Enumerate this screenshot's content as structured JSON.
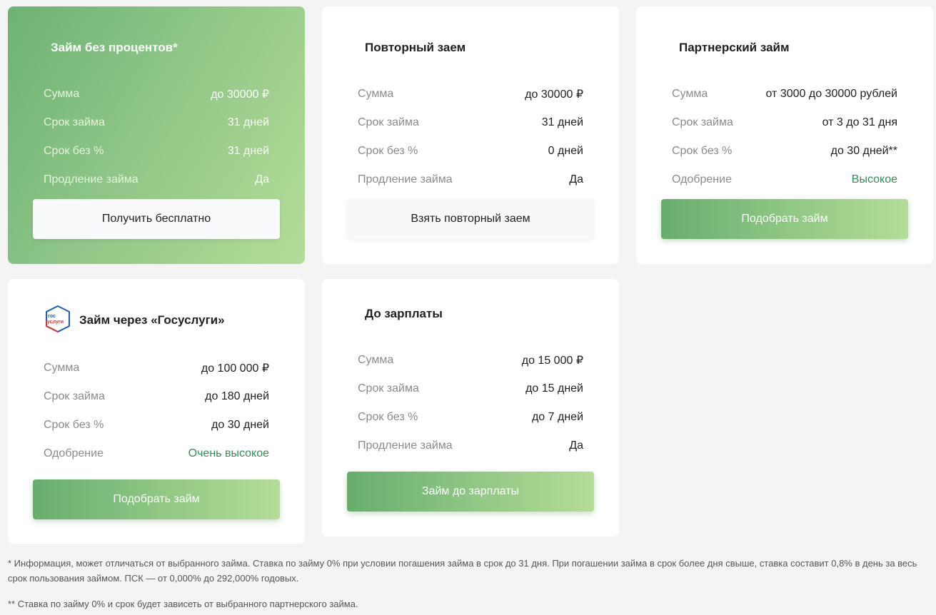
{
  "cards": [
    {
      "title": "Займ без процентов*",
      "rows": [
        {
          "label": "Сумма",
          "value": "до 30000 ₽"
        },
        {
          "label": "Срок займа",
          "value": "31 дней"
        },
        {
          "label": "Срок без %",
          "value": "31 дней"
        },
        {
          "label": "Продление займа",
          "value": "Да"
        }
      ],
      "button": "Получить бесплатно"
    },
    {
      "title": "Повторный заем",
      "rows": [
        {
          "label": "Сумма",
          "value": "до 30000 ₽"
        },
        {
          "label": "Срок займа",
          "value": "31 дней"
        },
        {
          "label": "Срок без %",
          "value": "0 дней"
        },
        {
          "label": "Продление займа",
          "value": "Да"
        }
      ],
      "button": "Взять повторный заем"
    },
    {
      "title": "Партнерский займ",
      "rows": [
        {
          "label": "Сумма",
          "value": "от 3000 до 30000 рублей"
        },
        {
          "label": "Срок займа",
          "value": "от 3 до 31 дня"
        },
        {
          "label": "Срок без %",
          "value": "до 30 дней**"
        },
        {
          "label": "Одобрение",
          "value": "Высокое"
        }
      ],
      "button": "Подобрать займ"
    },
    {
      "title": "Займ через «Госуслуги»",
      "logo_text": "гос услуги",
      "rows": [
        {
          "label": "Сумма",
          "value": "до 100 000 ₽"
        },
        {
          "label": "Срок займа",
          "value": "до 180 дней"
        },
        {
          "label": "Срок без %",
          "value": "до 30 дней"
        },
        {
          "label": "Одобрение",
          "value": "Очень высокое"
        }
      ],
      "button": "Подобрать займ"
    },
    {
      "title": "До зарплаты",
      "rows": [
        {
          "label": "Сумма",
          "value": "до 15 000 ₽"
        },
        {
          "label": "Срок займа",
          "value": "до 15 дней"
        },
        {
          "label": "Срок без %",
          "value": "до 7 дней"
        },
        {
          "label": "Продление займа",
          "value": "Да"
        }
      ],
      "button": "Займ до зарплаты"
    }
  ],
  "footnotes": {
    "note1": "* Информация, может отличаться от выбранного займа. Ставка по займу 0% при условии погашения займа в срок до 31 дня. При погашении займа в срок более дня свыше, ставка составит 0,8% в день за весь срок пользования займом. ПСК — от 0,000% до 292,000% годовых.",
    "note2": "** Ставка по займу 0% и срок будет зависеть от выбранного партнерского займа."
  },
  "colors": {
    "accent_green": "#2f8f55",
    "button_gradient_start": "#68ad6d",
    "button_gradient_end": "#b4dc98",
    "page_background": "#f4f4f4"
  }
}
